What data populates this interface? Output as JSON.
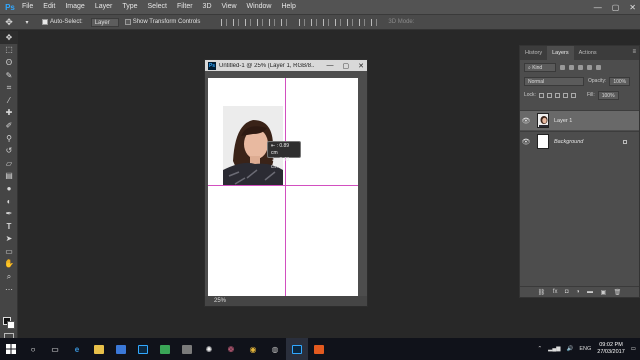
{
  "app": {
    "logo_text": "Ps"
  },
  "menu": [
    "File",
    "Edit",
    "Image",
    "Layer",
    "Type",
    "Select",
    "Filter",
    "3D",
    "View",
    "Window",
    "Help"
  ],
  "window_controls": {
    "minimize": "—",
    "restore": "▢",
    "close": "✕"
  },
  "options": {
    "auto_select_label": "Auto-Select:",
    "auto_select_target": "Layer",
    "show_transform_label": "Show Transform Controls",
    "mode_3d_label": "3D Mode:"
  },
  "document": {
    "title": "Untitled-1 @ 25% (Layer 1, RGB/8...",
    "zoom": "25%",
    "tooltip_x": "0.89 cm",
    "tooltip_y": "0.48 cm",
    "tooltip_x_prefix": "⇤ :",
    "tooltip_y_prefix": "⇣ :"
  },
  "layers_panel": {
    "tabs": [
      "History",
      "Layers",
      "Actions"
    ],
    "active_tab": "Layers",
    "filter_label": "Kind",
    "blend_mode": "Normal",
    "opacity_label": "Opacity:",
    "opacity_value": "100%",
    "lock_label": "Lock:",
    "fill_label": "Fill:",
    "fill_value": "100%",
    "layers": [
      {
        "name": "Layer 1",
        "selected": true
      },
      {
        "name": "Background",
        "selected": false
      }
    ]
  },
  "taskbar": {
    "language": "ENG",
    "time": "09:02 PM",
    "date": "27/03/2017"
  },
  "colors": {
    "accent": "#31a8ff",
    "guide": "#d24fc0"
  }
}
